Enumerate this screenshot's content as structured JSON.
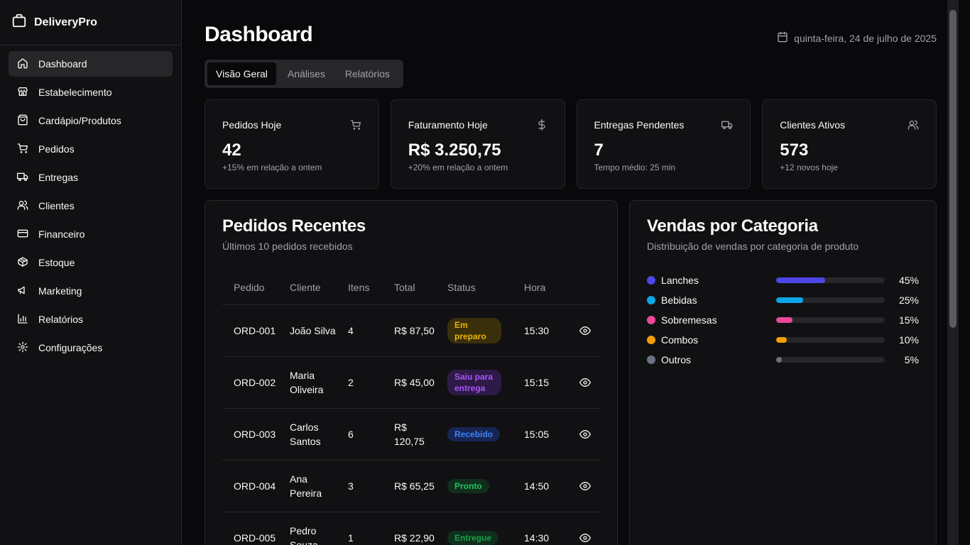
{
  "app": {
    "name": "DeliveryPro"
  },
  "sidebar": {
    "items": [
      {
        "label": "Dashboard",
        "icon": "home-icon"
      },
      {
        "label": "Estabelecimento",
        "icon": "store-icon"
      },
      {
        "label": "Cardápio/Produtos",
        "icon": "shopping-bag-icon"
      },
      {
        "label": "Pedidos",
        "icon": "cart-icon"
      },
      {
        "label": "Entregas",
        "icon": "truck-icon"
      },
      {
        "label": "Clientes",
        "icon": "users-icon"
      },
      {
        "label": "Financeiro",
        "icon": "credit-card-icon"
      },
      {
        "label": "Estoque",
        "icon": "package-icon"
      },
      {
        "label": "Marketing",
        "icon": "megaphone-icon"
      },
      {
        "label": "Relatórios",
        "icon": "bar-chart-icon"
      },
      {
        "label": "Configurações",
        "icon": "gear-icon"
      }
    ]
  },
  "header": {
    "title": "Dashboard",
    "date": "quinta-feira, 24 de julho de 2025"
  },
  "tabs": [
    {
      "label": "Visão Geral"
    },
    {
      "label": "Análises"
    },
    {
      "label": "Relatórios"
    }
  ],
  "stats": [
    {
      "title": "Pedidos Hoje",
      "value": "42",
      "sub": "+15% em relação a ontem",
      "icon": "cart-icon"
    },
    {
      "title": "Faturamento Hoje",
      "value": "R$ 3.250,75",
      "sub": "+20% em relação a ontem",
      "icon": "dollar-icon"
    },
    {
      "title": "Entregas Pendentes",
      "value": "7",
      "sub": "Tempo médio: 25 min",
      "icon": "truck-icon"
    },
    {
      "title": "Clientes Ativos",
      "value": "573",
      "sub": "+12 novos hoje",
      "icon": "users-icon"
    }
  ],
  "orders": {
    "title": "Pedidos Recentes",
    "description": "Últimos 10 pedidos recebidos",
    "columns": [
      "Pedido",
      "Cliente",
      "Itens",
      "Total",
      "Status",
      "Hora"
    ],
    "rows": [
      {
        "id": "ORD-001",
        "client": "João Silva",
        "items": "4",
        "total": "R$ 87,50",
        "status": "Em preparo",
        "status_color": "#eab308",
        "status_bg": "#3a2f0b",
        "time": "15:30"
      },
      {
        "id": "ORD-002",
        "client": "Maria Oliveira",
        "items": "2",
        "total": "R$ 45,00",
        "status": "Saiu para entrega",
        "status_color": "#a855f7",
        "status_bg": "#2e1a47",
        "time": "15:15"
      },
      {
        "id": "ORD-003",
        "client": "Carlos Santos",
        "items": "6",
        "total": "R$ 120,75",
        "status": "Recebido",
        "status_color": "#3b82f6",
        "status_bg": "#172554",
        "time": "15:05"
      },
      {
        "id": "ORD-004",
        "client": "Ana Pereira",
        "items": "3",
        "total": "R$ 65,25",
        "status": "Pronto",
        "status_color": "#22c55e",
        "status_bg": "#0f2e1b",
        "time": "14:50"
      },
      {
        "id": "ORD-005",
        "client": "Pedro Souza",
        "items": "1",
        "total": "R$ 22,90",
        "status": "Entregue",
        "status_color": "#16a34a",
        "status_bg": "#0f2e1b",
        "time": "14:30"
      }
    ]
  },
  "sales": {
    "title": "Vendas por Categoria",
    "description": "Distribuição de vendas por categoria de produto",
    "categories": [
      {
        "name": "Lanches",
        "percent": 45,
        "label": "45%",
        "color": "#4f46e5"
      },
      {
        "name": "Bebidas",
        "percent": 25,
        "label": "25%",
        "color": "#0ea5e9"
      },
      {
        "name": "Sobremesas",
        "percent": 15,
        "label": "15%",
        "color": "#ec4899"
      },
      {
        "name": "Combos",
        "percent": 10,
        "label": "10%",
        "color": "#f59e0b"
      },
      {
        "name": "Outros",
        "percent": 5,
        "label": "5%",
        "color": "#6b7280"
      }
    ]
  }
}
